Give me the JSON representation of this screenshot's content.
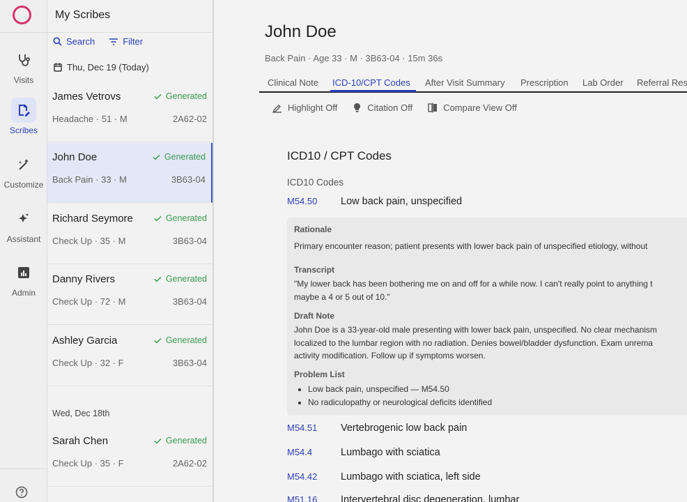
{
  "sidebar": {
    "items": [
      {
        "label": "Visits",
        "icon": "stethoscope-icon"
      },
      {
        "label": "Scribes",
        "icon": "scribe-icon"
      },
      {
        "label": "Customize",
        "icon": "wand-icon"
      },
      {
        "label": "Assistant",
        "icon": "sparkle-icon"
      },
      {
        "label": "Admin",
        "icon": "chart-icon"
      }
    ],
    "help_icon": "help-icon"
  },
  "list": {
    "title": "My Scribes",
    "search_label": "Search",
    "filter_label": "Filter",
    "today_label": "Thu, Dec 19 (Today)",
    "entries": [
      {
        "name": "James Vetrovs",
        "meta": "Headache · 51 · M",
        "status": "Generated",
        "code": "2A62-02"
      },
      {
        "name": "John Doe",
        "meta": "Back Pain · 33 · M",
        "status": "Generated",
        "code": "3B63-04"
      },
      {
        "name": "Richard Seymore",
        "meta": "Check Up · 35 · M",
        "status": "Generated",
        "code": "3B63-04"
      },
      {
        "name": "Danny Rivers",
        "meta": "Check Up · 72 · M",
        "status": "Generated",
        "code": "3B63-04"
      },
      {
        "name": "Ashley Garcia",
        "meta": "Check Up · 32 · F",
        "status": "Generated",
        "code": "3B63-04"
      }
    ],
    "earlier_date": "Wed, Dec 18th",
    "earlier_entries": [
      {
        "name": "Sarah Chen",
        "meta": "Check Up · 35 · F",
        "status": "Generated",
        "code": "2A62-02"
      }
    ]
  },
  "main": {
    "patient_name": "John Doe",
    "patient_meta": "Back Pain · Age 33 · M · 3B63-04 · 15m 36s",
    "tabs": [
      {
        "label": "Clinical Note"
      },
      {
        "label": "ICD-10/CPT Codes"
      },
      {
        "label": "After Visit Summary"
      },
      {
        "label": "Prescription"
      },
      {
        "label": "Lab Order"
      },
      {
        "label": "Referral Res"
      }
    ],
    "toolbar": {
      "highlight": "Highlight Off",
      "citation": "Citation Off",
      "compare": "Compare View Off"
    },
    "section_title": "ICD10 / CPT Codes",
    "subsection_title": "ICD10 Codes",
    "codes": [
      {
        "code": "M54.50",
        "desc": "Low back pain, unspecified"
      },
      {
        "code": "M54.51",
        "desc": "Vertebrogenic low back pain"
      },
      {
        "code": "M54.4",
        "desc": "Lumbago with sciatica"
      },
      {
        "code": "M54.42",
        "desc": "Lumbago with sciatica, left side"
      },
      {
        "code": "M51.16",
        "desc": "Intervertebral disc degeneration, lumbar"
      }
    ],
    "detail": {
      "rationale_title": "Rationale",
      "rationale": "Primary encounter reason; patient presents with lower back pain of unspecified etiology, without",
      "transcript_title": "Transcript",
      "transcript_1": "\"My lower back has been bothering me on and off for a while now. I can't really point to anything t",
      "transcript_2": "maybe a 4 or 5 out of 10.\"",
      "draft_title": "Draft Note",
      "draft_1": "John Doe is a 33-year-old male presenting with lower back pain, unspecified. No clear mechanism",
      "draft_2": "localized to the lumbar region with no radiation. Denies bowel/bladder dysfunction. Exam unrema",
      "draft_3": "activity modification. Follow up if symptoms worsen.",
      "problem_title": "Problem List",
      "problems": [
        "Low back pain, unspecified — M54.50",
        "No radiculopathy or neurological deficits identified"
      ]
    }
  },
  "colors": {
    "accent": "#2a3fb8",
    "brand": "#d6336c",
    "status": "#3a9b51"
  }
}
